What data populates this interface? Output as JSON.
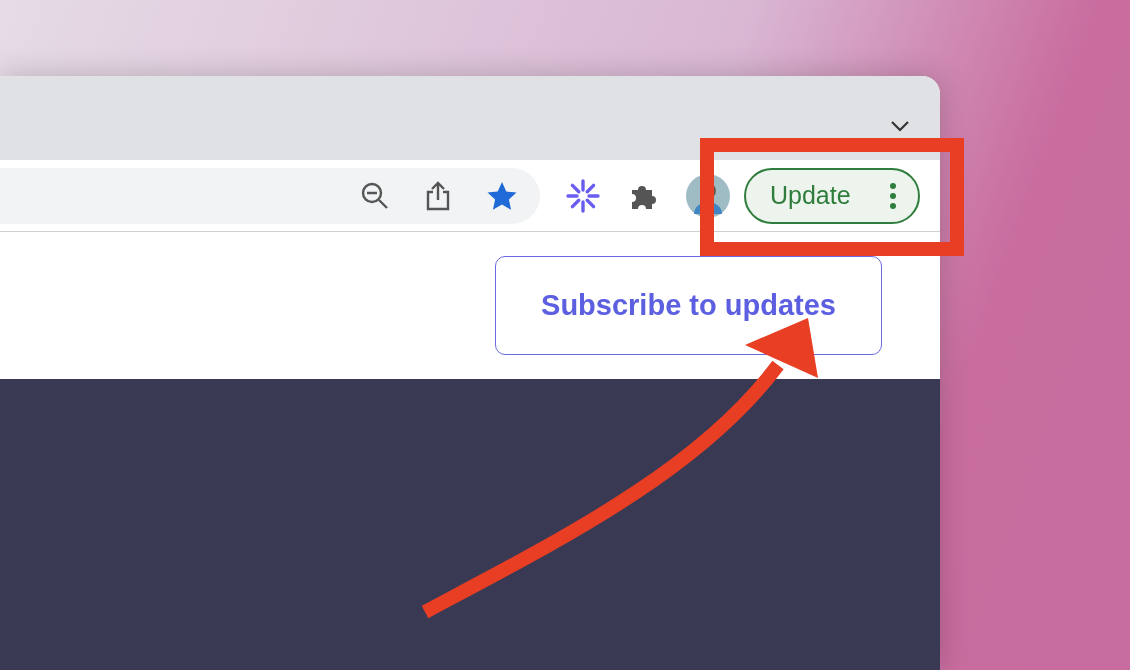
{
  "toolbar": {
    "bookmarked": true,
    "update_button": "Update"
  },
  "page": {
    "subscribe_button": "Subscribe to updates"
  }
}
